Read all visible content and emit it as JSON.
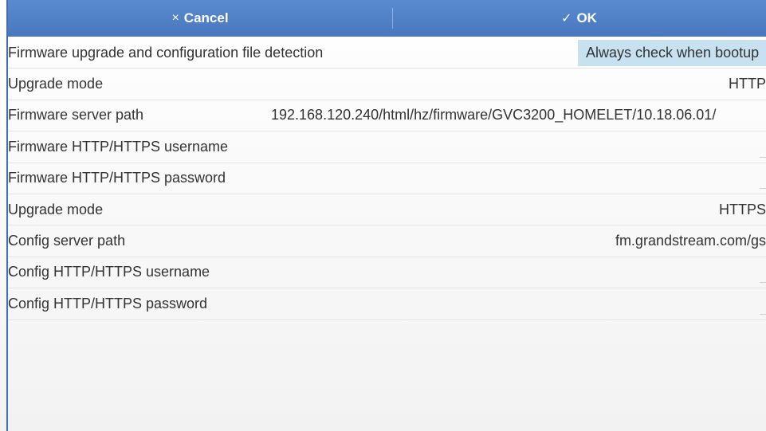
{
  "toolbar": {
    "cancel_icon": "×",
    "cancel_label": "Cancel",
    "ok_icon": "✓",
    "ok_label": "OK",
    "color": "#4a7bc1"
  },
  "rows": [
    {
      "label": "Firmware upgrade and configuration file detection",
      "value": "Always check when bootup",
      "kind": "select"
    },
    {
      "label": "Upgrade mode",
      "value": "HTTP",
      "kind": "text"
    },
    {
      "label": "Firmware server path",
      "value": "192.168.120.240/html/hz/firmware/GVC3200_HOMELET/10.18.06.01/",
      "kind": "path"
    },
    {
      "label": "Firmware HTTP/HTTPS username",
      "value": "",
      "kind": "empty"
    },
    {
      "label": "Firmware HTTP/HTTPS password",
      "value": "",
      "kind": "empty"
    },
    {
      "label": "Upgrade mode",
      "value": "HTTPS",
      "kind": "text"
    },
    {
      "label": "Config server path",
      "value": "fm.grandstream.com/gs",
      "kind": "text"
    },
    {
      "label": "Config HTTP/HTTPS username",
      "value": "",
      "kind": "empty"
    },
    {
      "label": "Config HTTP/HTTPS password",
      "value": "",
      "kind": "empty"
    }
  ]
}
